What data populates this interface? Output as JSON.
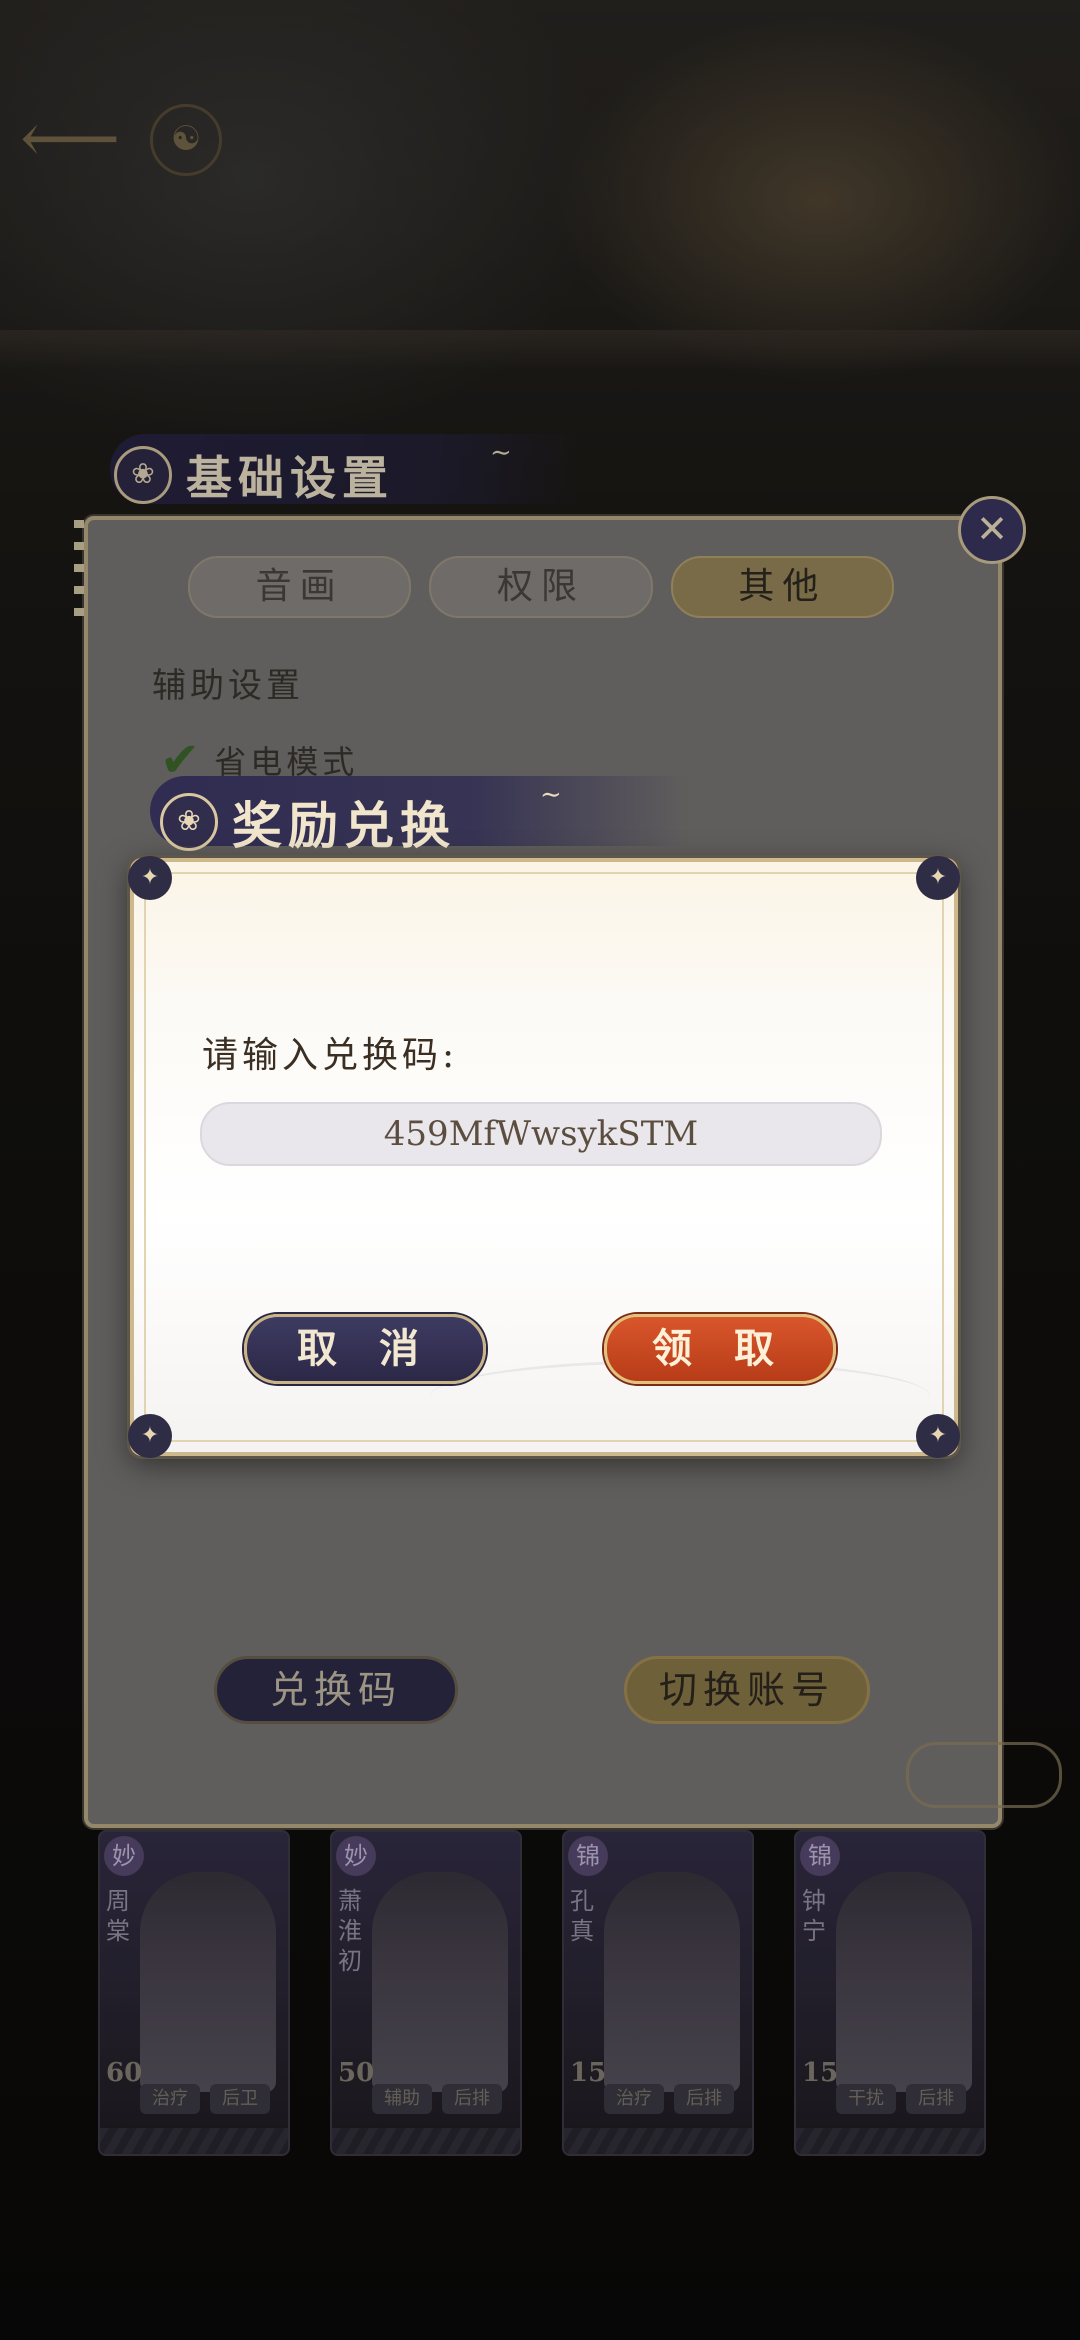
{
  "settings": {
    "title": "基础设置",
    "tabs": [
      "音画",
      "权限",
      "其他"
    ],
    "active_tab": "其他",
    "section": "辅助设置",
    "option": {
      "label": "省电模式",
      "checked": true
    },
    "buttons": {
      "redeem": "兑换码",
      "switch_account": "切换账号"
    }
  },
  "dialog": {
    "title": "奖励兑换",
    "prompt": "请输入兑换码:",
    "code": "459MfWwsykSTM",
    "cancel": "取 消",
    "claim": "领 取"
  },
  "cards": [
    {
      "tag": "妙",
      "name": "周棠",
      "level": "60",
      "actions": [
        "治疗",
        "后卫"
      ]
    },
    {
      "tag": "妙",
      "name": "萧淮初",
      "level": "50",
      "actions": [
        "辅助",
        "后排"
      ]
    },
    {
      "tag": "锦",
      "name": "孔真",
      "level": "15",
      "actions": [
        "治疗",
        "后排"
      ]
    },
    {
      "tag": "锦",
      "name": "钟宁",
      "level": "15",
      "actions": [
        "干扰",
        "后排"
      ]
    }
  ]
}
